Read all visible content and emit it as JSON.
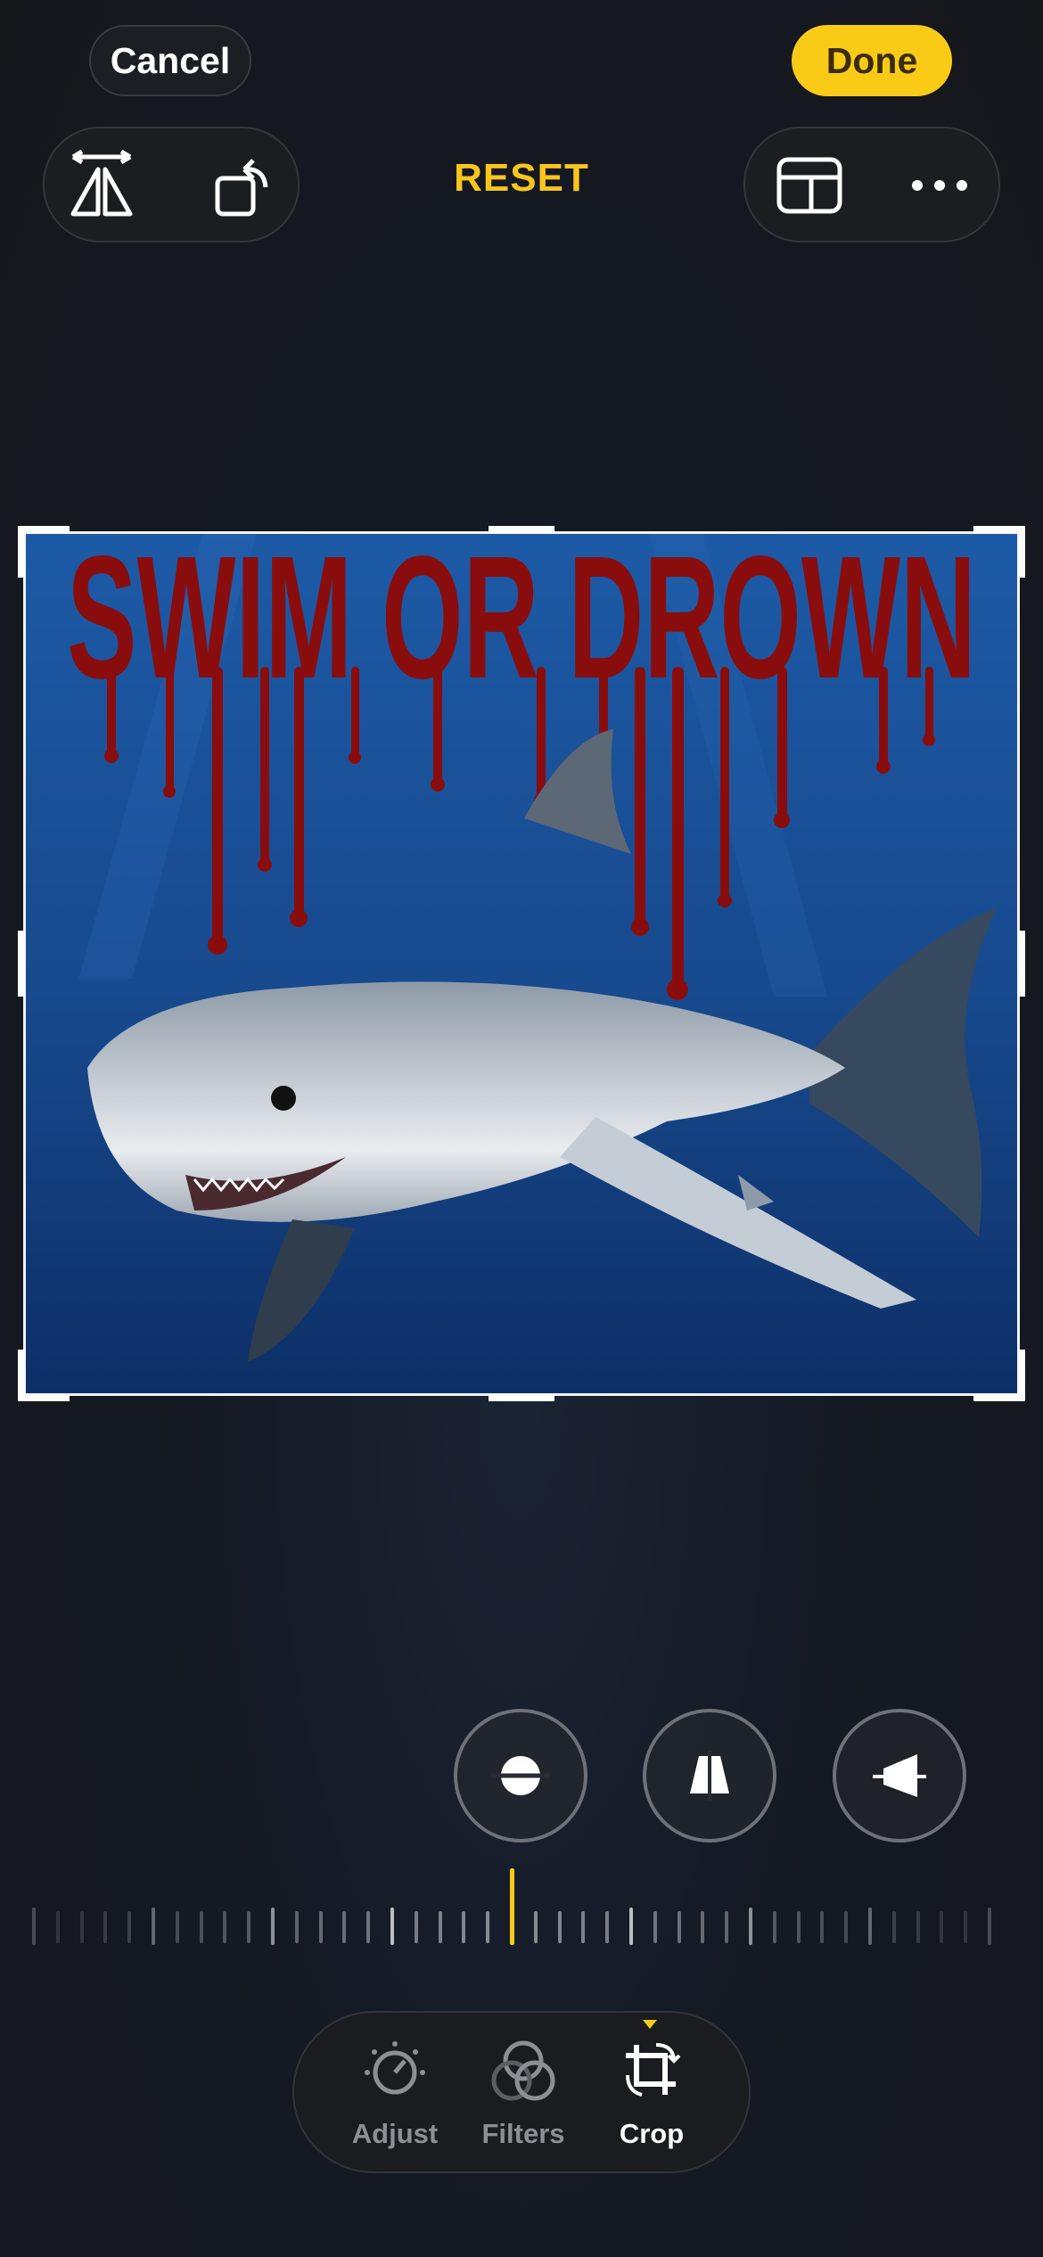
{
  "header": {
    "cancel_label": "Cancel",
    "done_label": "Done",
    "reset_label": "RESET"
  },
  "toolbar": {
    "left": [
      "flip-horizontal-icon",
      "rotate-icon"
    ],
    "right": [
      "aspect-ratio-icon",
      "more-icon"
    ]
  },
  "photo": {
    "headline": "SWIM OR DROWN",
    "subject": "great white shark",
    "background_color": "#1b4f94",
    "headline_color": "#8a0d0d"
  },
  "perspective_controls": [
    "straighten-icon",
    "vertical-perspective-icon",
    "horizontal-perspective-icon"
  ],
  "tabs": [
    {
      "label": "Adjust",
      "icon": "adjust-icon",
      "active": false
    },
    {
      "label": "Filters",
      "icon": "filters-icon",
      "active": false
    },
    {
      "label": "Crop",
      "icon": "crop-icon",
      "active": true
    }
  ],
  "colors": {
    "accent": "#f9cb17",
    "background": "#16171b"
  }
}
